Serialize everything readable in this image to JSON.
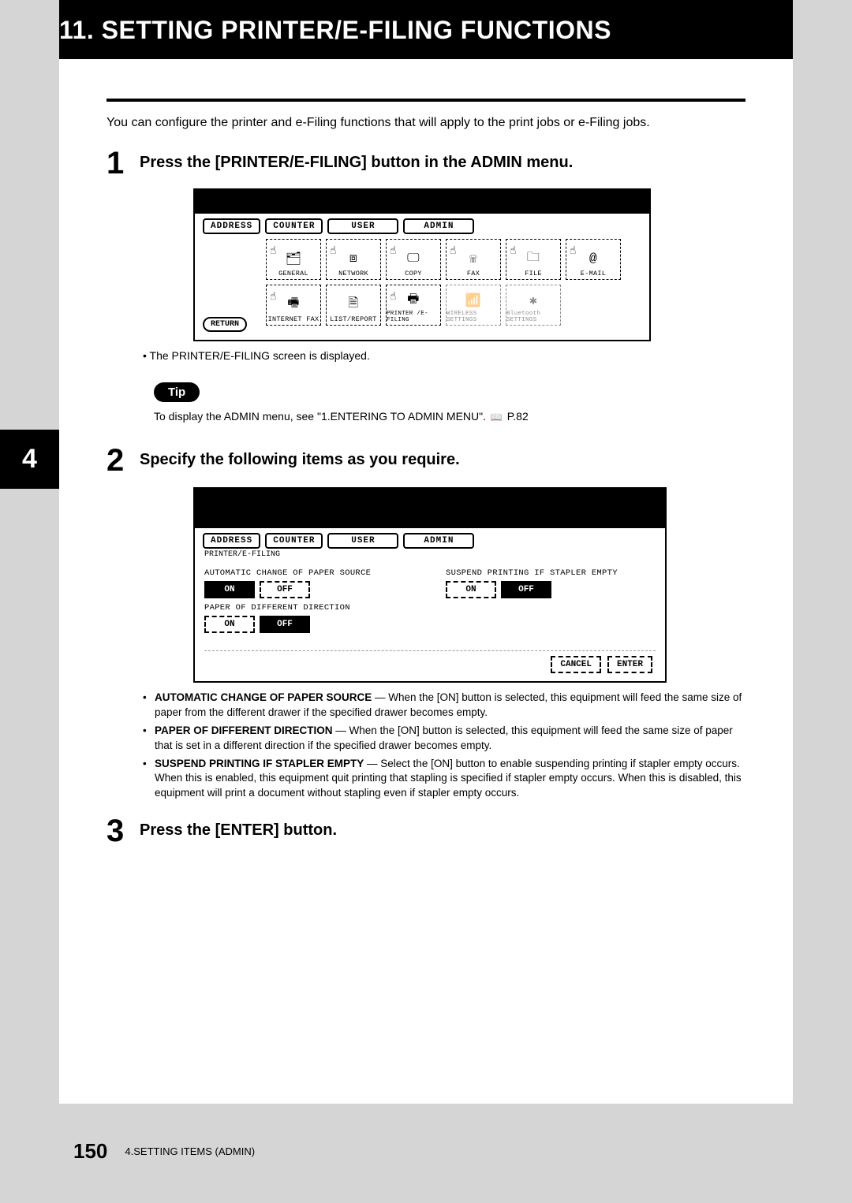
{
  "chapter_title": "11. SETTING PRINTER/E-FILING FUNCTIONS",
  "side_tab": "4",
  "intro": "You can configure the printer and e-Filing functions that will apply to the print jobs or e-Filing jobs.",
  "step1": {
    "num": "1",
    "title": "Press the [PRINTER/E-FILING] button in the ADMIN menu.",
    "tabs": [
      "ADDRESS",
      "COUNTER",
      "USER",
      "ADMIN"
    ],
    "icons_r1": [
      "GENERAL",
      "NETWORK",
      "COPY",
      "FAX",
      "FILE",
      "E-MAIL"
    ],
    "icons_r2": [
      "INTERNET FAX",
      "LIST/REPORT",
      "PRINTER /E-FILING",
      "WIRELESS SETTINGS",
      "Bluetooth SETTINGS"
    ],
    "return": "RETURN",
    "bullet": "The PRINTER/E-FILING screen is displayed."
  },
  "tip": {
    "label": "Tip",
    "text_a": "To display the ADMIN menu, see \"1.ENTERING TO ADMIN MENU\".",
    "page_ref": "P.82"
  },
  "step2": {
    "num": "2",
    "title": "Specify the following items as you require.",
    "tabs": [
      "ADDRESS",
      "COUNTER",
      "USER",
      "ADMIN"
    ],
    "breadcrumb": "PRINTER/E-FILING",
    "opt1_label": "AUTOMATIC CHANGE OF PAPER SOURCE",
    "opt2_label": "PAPER OF DIFFERENT DIRECTION",
    "opt3_label": "SUSPEND PRINTING IF STAPLER EMPTY",
    "on": "ON",
    "off": "OFF",
    "cancel": "CANCEL",
    "enter": "ENTER",
    "desc": {
      "d1a": "AUTOMATIC CHANGE OF PAPER SOURCE",
      "d1b": " — When the [ON] button is selected, this equipment will feed the same size of paper from the different drawer if the specified drawer becomes empty.",
      "d2a": "PAPER OF DIFFERENT DIRECTION",
      "d2b": " — When the [ON] button is selected, this equipment will feed the same size of paper that is set in a different direction if the specified drawer becomes empty.",
      "d3a": "SUSPEND PRINTING IF STAPLER EMPTY",
      "d3b": " — Select the [ON] button to enable suspending printing if stapler empty occurs.  When this is enabled, this equipment quit printing that stapling is specified if stapler empty occurs.  When this is disabled, this equipment will print a document without stapling even if stapler empty occurs."
    }
  },
  "step3": {
    "num": "3",
    "title": "Press the [ENTER] button."
  },
  "footer": {
    "page": "150",
    "text": "4.SETTING ITEMS (ADMIN)"
  }
}
